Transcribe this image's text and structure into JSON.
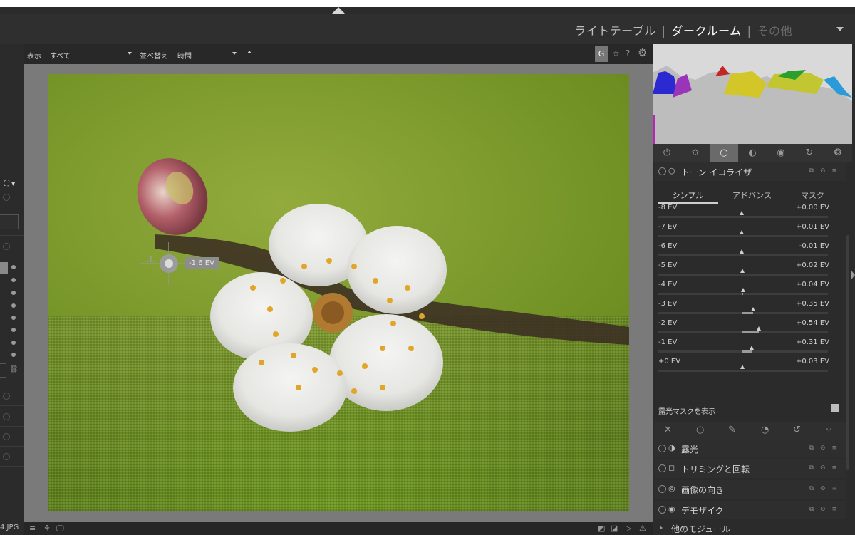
{
  "header": {
    "nav": {
      "lighttable": "ライトテーブル",
      "darkroom": "ダークルーム",
      "other": "その他",
      "separator": "|"
    }
  },
  "toolbar": {
    "view_label": "表示",
    "view_value": "すべて",
    "sort_label": "並べ替え",
    "sort_value": "時間",
    "grouping_label": "G",
    "star_icon": "☆",
    "help_icon": "?",
    "gear_icon": "⚙"
  },
  "left_panel": {
    "filename_fragment": "4.JPG"
  },
  "canvas_overlay": {
    "ev_label": "-1.6 EV"
  },
  "right_panel": {
    "module_groups": [
      "power-icon",
      "star-icon",
      "base-circle-icon",
      "tone-icon",
      "color-icon",
      "correct-icon",
      "effect-icon"
    ],
    "active_group": 2,
    "tone_equalizer": {
      "title": "トーン イコライザ",
      "tabs": [
        "シンプル",
        "アドバンス",
        "マスク"
      ],
      "active_tab": 0,
      "rows": [
        {
          "label": "-8 EV",
          "value": "+0.00 EV",
          "level": 0.0
        },
        {
          "label": "-7 EV",
          "value": "+0.01 EV",
          "level": 0.01
        },
        {
          "label": "-6 EV",
          "value": "-0.01 EV",
          "level": -0.01
        },
        {
          "label": "-5 EV",
          "value": "+0.02 EV",
          "level": 0.02
        },
        {
          "label": "-4 EV",
          "value": "+0.04 EV",
          "level": 0.04
        },
        {
          "label": "-3 EV",
          "value": "+0.35 EV",
          "level": 0.35
        },
        {
          "label": "-2 EV",
          "value": "+0.54 EV",
          "level": 0.54
        },
        {
          "label": "-1 EV",
          "value": "+0.31 EV",
          "level": 0.31
        },
        {
          "label": "+0 EV",
          "value": "+0.03 EV",
          "level": 0.03
        }
      ],
      "mask_toggle_label": "露光マスクを表示"
    },
    "modules": [
      {
        "title": "露光",
        "icon": "exposure-icon"
      },
      {
        "title": "トリミングと回転",
        "icon": "crop-icon"
      },
      {
        "title": "画像の向き",
        "icon": "orientation-icon"
      },
      {
        "title": "デモザイク",
        "icon": "demosaic-icon"
      }
    ],
    "more_modules": "他のモジュール"
  }
}
